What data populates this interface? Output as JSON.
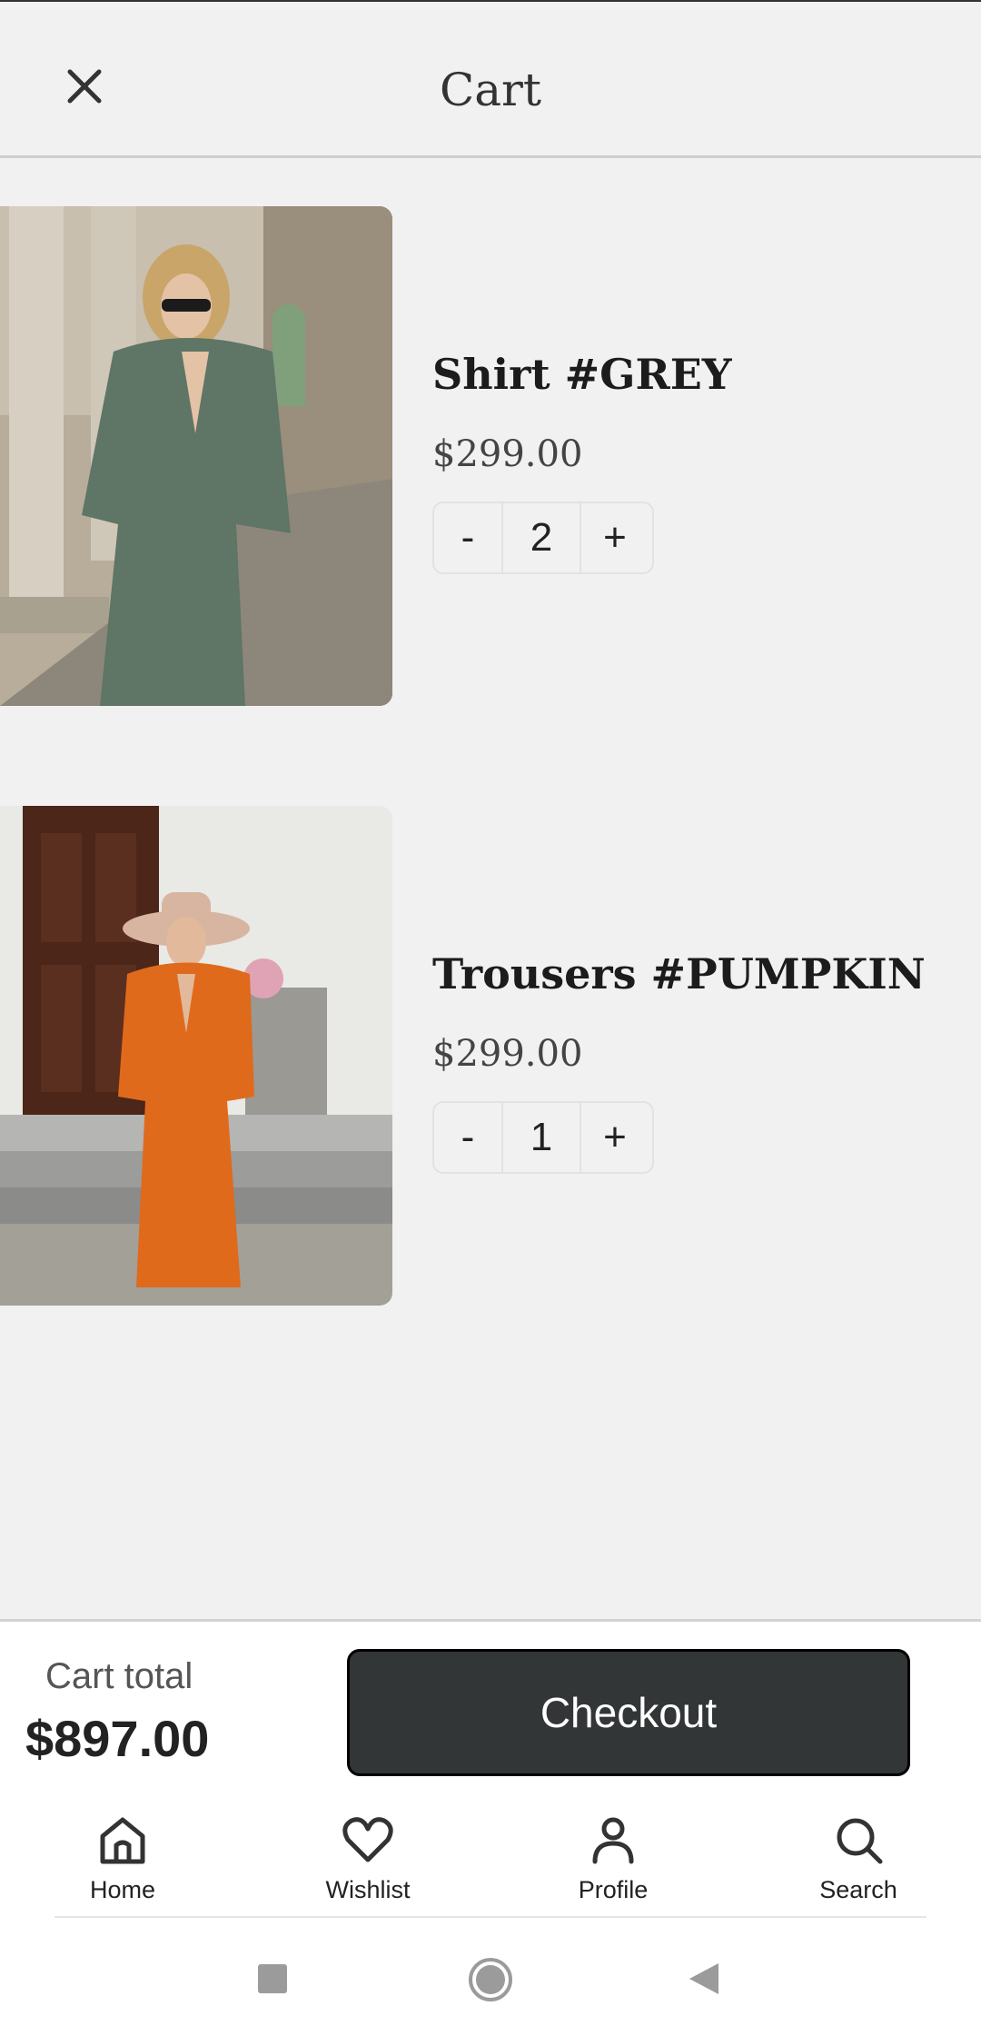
{
  "header": {
    "title": "Cart",
    "close_icon": "close-icon"
  },
  "items": [
    {
      "name": "Shirt #GREY",
      "price": "$299.00",
      "quantity": "2",
      "minus": "-",
      "plus": "+"
    },
    {
      "name": "Trousers #PUMPKIN",
      "price": "$299.00",
      "quantity": "1",
      "minus": "-",
      "plus": "+"
    }
  ],
  "summary": {
    "label": "Cart total",
    "total": "$897.00",
    "checkout_label": "Checkout"
  },
  "nav": [
    {
      "label": "Home",
      "icon": "home-icon"
    },
    {
      "label": "Wishlist",
      "icon": "heart-icon"
    },
    {
      "label": "Profile",
      "icon": "person-icon"
    },
    {
      "label": "Search",
      "icon": "search-icon"
    }
  ],
  "system_nav": [
    "recent-apps-icon",
    "home-circle-icon",
    "back-icon"
  ],
  "colors": {
    "background": "#f1f1f1",
    "checkout_button": "#333637",
    "text": "#222222"
  }
}
